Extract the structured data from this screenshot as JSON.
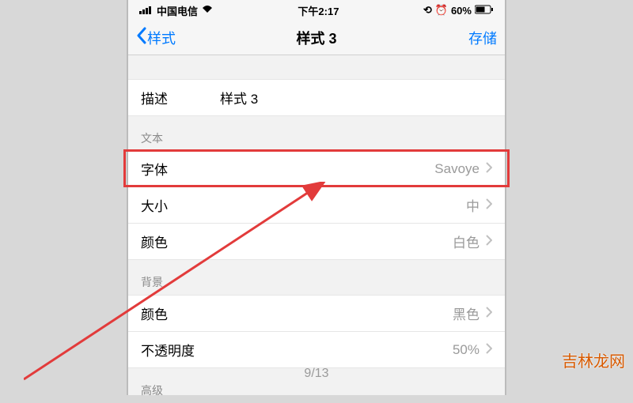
{
  "status": {
    "carrier": "中国电信",
    "time": "下午2:17",
    "battery": "60%"
  },
  "nav": {
    "back": "样式",
    "title": "样式 3",
    "save": "存储"
  },
  "description": {
    "label": "描述",
    "value": "样式 3"
  },
  "sections": {
    "text": "文本",
    "background": "背景",
    "advanced": "高级"
  },
  "text_group": {
    "font_label": "字体",
    "font_value": "Savoye",
    "size_label": "大小",
    "size_value": "中",
    "color_label": "颜色",
    "color_value": "白色"
  },
  "bg_group": {
    "color_label": "颜色",
    "color_value": "黑色",
    "opacity_label": "不透明度",
    "opacity_value": "50%"
  },
  "pager": "9/13",
  "watermark": "吉林龙网"
}
